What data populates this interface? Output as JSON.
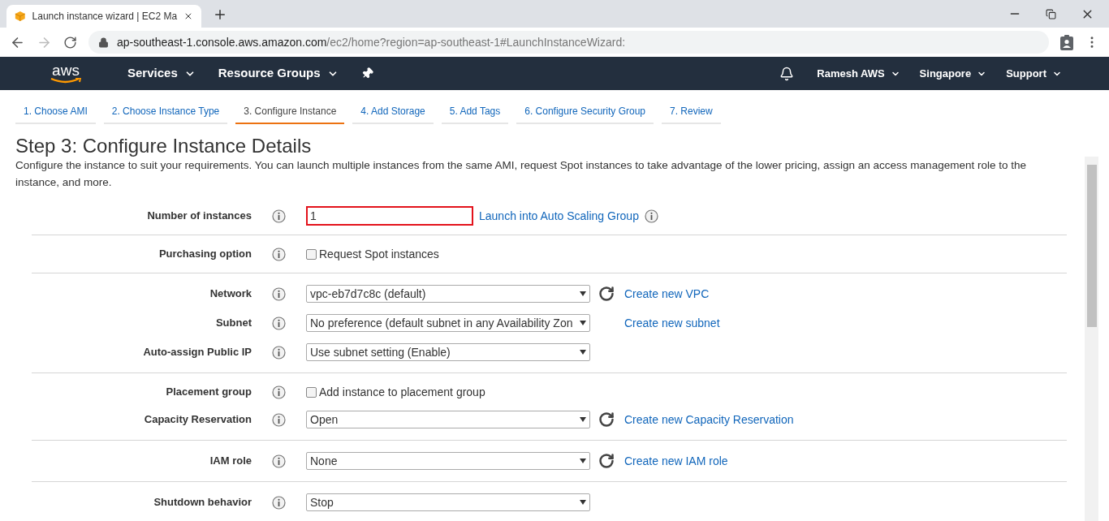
{
  "browser_tab": {
    "title": "Launch instance wizard | EC2 Ma"
  },
  "url": {
    "host": "ap-southeast-1.console.aws.amazon.com",
    "path": "/ec2/home?region=ap-southeast-1#LaunchInstanceWizard:"
  },
  "aws_nav": {
    "logo": "aws",
    "left": [
      {
        "label": "Services"
      },
      {
        "label": "Resource Groups"
      }
    ],
    "right": [
      {
        "label": "Ramesh AWS"
      },
      {
        "label": "Singapore"
      },
      {
        "label": "Support"
      }
    ]
  },
  "wizard_steps": [
    {
      "label": "1. Choose AMI",
      "selected": false
    },
    {
      "label": "2. Choose Instance Type",
      "selected": false
    },
    {
      "label": "3. Configure Instance",
      "selected": true
    },
    {
      "label": "4. Add Storage",
      "selected": false
    },
    {
      "label": "5. Add Tags",
      "selected": false
    },
    {
      "label": "6. Configure Security Group",
      "selected": false
    },
    {
      "label": "7. Review",
      "selected": false
    }
  ],
  "page": {
    "title": "Step 3: Configure Instance Details",
    "description": "Configure the instance to suit your requirements. You can launch multiple instances from the same AMI, request Spot instances to take advantage of the lower pricing, assign an access management role to the instance, and more."
  },
  "sections": [
    {
      "fields": [
        {
          "label": "Number of instances",
          "kind": "text",
          "value": "1",
          "highlighted": true,
          "link": "Launch into Auto Scaling Group",
          "link_info": true
        }
      ]
    },
    {
      "fields": [
        {
          "label": "Purchasing option",
          "kind": "checkbox",
          "text": "Request Spot instances",
          "checked": false
        }
      ]
    },
    {
      "fields": [
        {
          "label": "Network",
          "kind": "select",
          "value": "vpc-eb7d7c8c (default)",
          "refresh": true,
          "link": "Create new VPC"
        },
        {
          "label": "Subnet",
          "kind": "select",
          "value": "No preference (default subnet in any Availability Zon",
          "refresh": false,
          "link": "Create new subnet"
        },
        {
          "label": "Auto-assign Public IP",
          "kind": "select",
          "value": "Use subnet setting (Enable)",
          "refresh": false
        }
      ]
    },
    {
      "fields": [
        {
          "label": "Placement group",
          "kind": "checkbox",
          "text": "Add instance to placement group",
          "checked": false
        },
        {
          "label": "Capacity Reservation",
          "kind": "select",
          "value": "Open",
          "refresh": true,
          "link": "Create new Capacity Reservation"
        }
      ]
    },
    {
      "fields": [
        {
          "label": "IAM role",
          "kind": "select",
          "value": "None",
          "refresh": true,
          "link": "Create new IAM role"
        }
      ]
    },
    {
      "fields": [
        {
          "label": "Shutdown behavior",
          "kind": "select",
          "value": "Stop",
          "refresh": false
        }
      ]
    }
  ]
}
